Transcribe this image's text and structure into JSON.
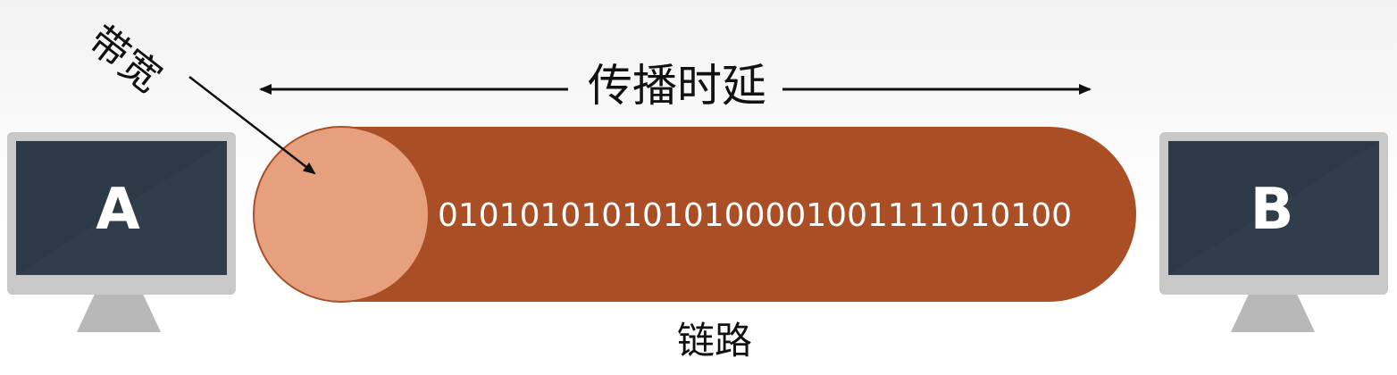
{
  "diagram": {
    "computer_a_label": "A",
    "computer_b_label": "B",
    "bitstream": "0101010101010100001001111010100",
    "propagation_delay_label": "传播时延",
    "bandwidth_label": "带宽",
    "link_label": "链路"
  },
  "colors": {
    "pipe_body": "#a94e25",
    "pipe_end": "#e6a07d",
    "screen": "#2c3a47",
    "monitor_frame": "#c8c8c8",
    "monitor_stand": "#b8b8b8"
  }
}
